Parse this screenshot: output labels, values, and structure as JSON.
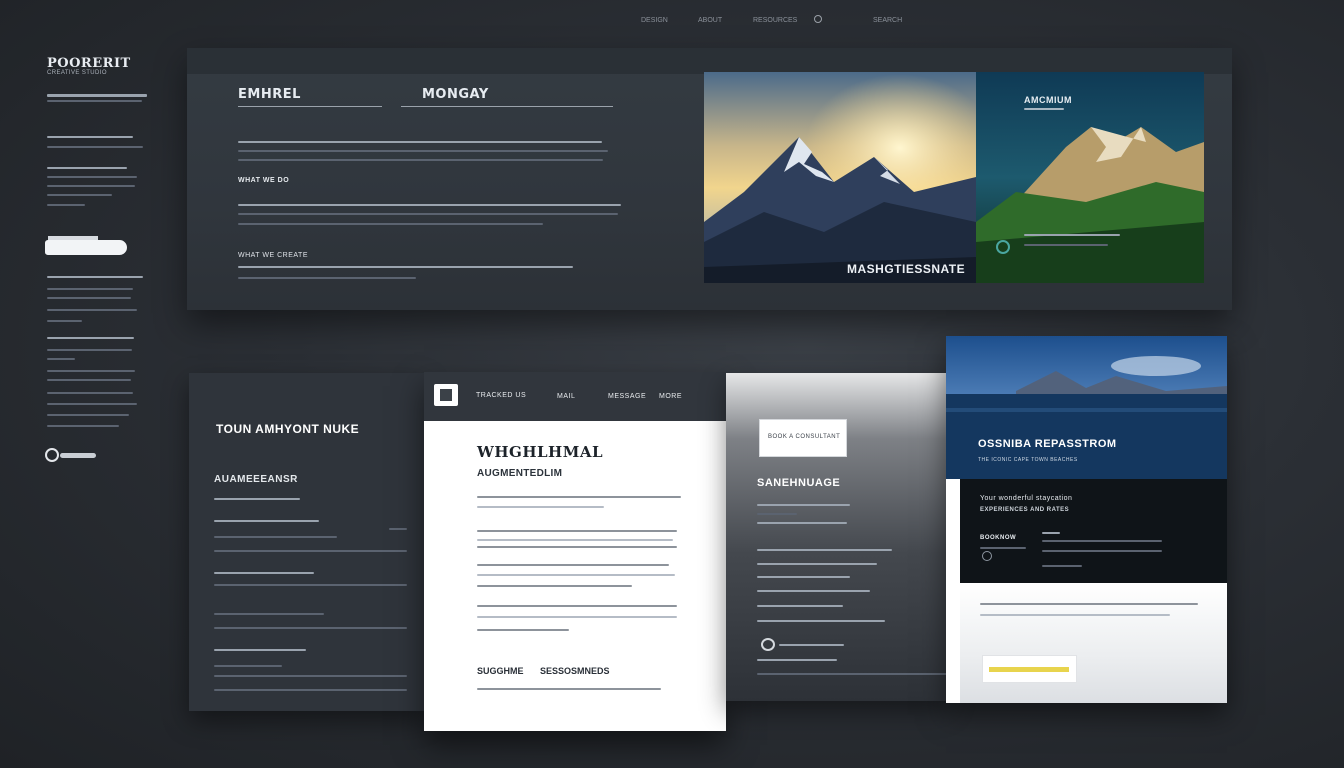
{
  "topnav": {
    "items": [
      "DESIGN",
      "ABOUT",
      "RESOURCES",
      "",
      "SEARCH"
    ]
  },
  "sidebar": {
    "brand": "POORERIT",
    "brand_sub": "CREATIVE STUDIO",
    "search_placeholder": ""
  },
  "hero": {
    "tab1": "EMHREL",
    "tab2": "MONGAY",
    "subhead": "WHAT WE DO",
    "subhead2": "WHAT WE CREATE",
    "photo_caption": "MASHGTIESSNATE",
    "photo2_title": "AMCMIUM"
  },
  "card_dark": {
    "title": "TOUN AMHYONT NUKE",
    "subtitle": "AUAMEEEANSR"
  },
  "card_doc": {
    "nav": [
      "TRACKED US",
      "MAIL",
      "MESSAGE",
      "MORE"
    ],
    "title": "WHGHLHMAL",
    "subtitle": "AUGMENTEDLIM",
    "footer_left": "SUGGHME",
    "footer_right": "SESSOSMNEDS"
  },
  "card_grad": {
    "button": "BOOK A CONSULTANT",
    "title": "SANEHNUAGE"
  },
  "card_lake": {
    "title": "OSSNIBA REPASSTROM",
    "subtitle": "THE ICONIC CAPE TOWN BEACHES",
    "heading": "Your wonderful staycation",
    "subheading": "EXPERIENCES AND RATES",
    "price_label": "BOOKNOW",
    "cta": ""
  },
  "colors": {
    "page_bg": "#2b2f35",
    "panel": "#30363d",
    "accent": "#e8d44d",
    "doc_bg": "#ffffff"
  }
}
